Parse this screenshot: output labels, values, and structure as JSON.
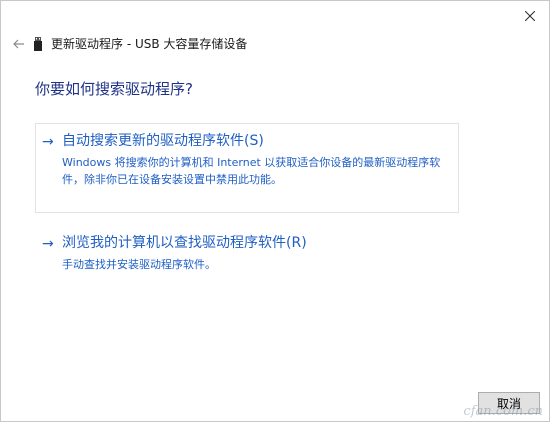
{
  "window": {
    "title": "更新驱动程序 - USB 大容量存储设备"
  },
  "titlebar": {
    "close_symbol": "✕"
  },
  "nav": {
    "back_symbol": "←"
  },
  "main": {
    "heading": "你要如何搜索驱动程序?",
    "options": [
      {
        "arrow": "→",
        "title": "自动搜索更新的驱动程序软件(S)",
        "description": "Windows 将搜索你的计算机和 Internet 以获取适合你设备的最新驱动程序软件，除非你已在设备安装设置中禁用此功能。"
      },
      {
        "arrow": "→",
        "title": "浏览我的计算机以查找驱动程序软件(R)",
        "description": "手动查找并安装驱动程序软件。"
      }
    ]
  },
  "footer": {
    "cancel_label": "取消"
  },
  "watermark": {
    "text": "cfan.com.cn"
  },
  "colors": {
    "heading": "#1e3287",
    "link": "#1f5fc4",
    "option_border": "#e3e3e3",
    "button_bg": "#e1e1e1",
    "button_border": "#adadad"
  }
}
